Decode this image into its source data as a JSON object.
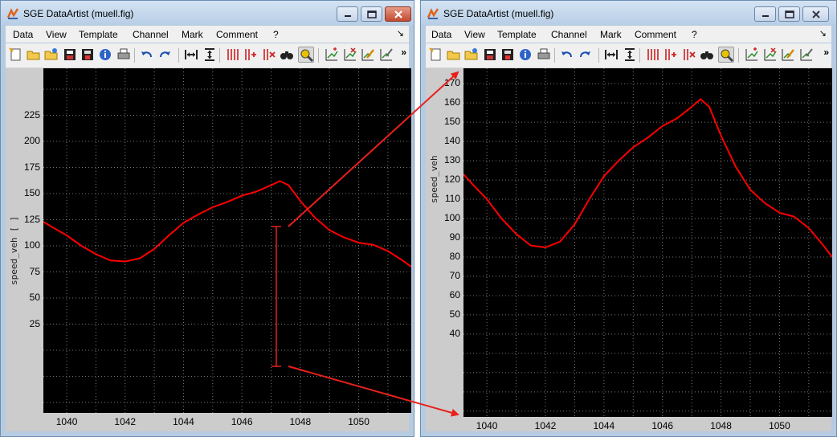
{
  "left_window": {
    "title": "SGE DataArtist (muell.fig)",
    "y_label": "speed_veh [ ]",
    "y_ticks": [
      "225",
      "200",
      "175",
      "150",
      "125",
      "100",
      "75",
      "50",
      "25"
    ],
    "x_ticks": [
      "1040",
      "1042",
      "1044",
      "1046",
      "1048",
      "1050"
    ]
  },
  "right_window": {
    "title": "SGE DataArtist (muell.fig)",
    "y_label": "speed_veh",
    "y_ticks": [
      "170",
      "160",
      "150",
      "140",
      "130",
      "120",
      "110",
      "100",
      "90",
      "80",
      "70",
      "60",
      "50",
      "40"
    ],
    "x_ticks": [
      "1040",
      "1042",
      "1044",
      "1046",
      "1048",
      "1050"
    ]
  },
  "menu": [
    "Data",
    "View",
    "Template",
    "Channel",
    "Mark",
    "Comment",
    "?"
  ],
  "menu_overflow": "↘",
  "toolbar_overflow": "»",
  "toolbar_icons": [
    "new-doc-icon",
    "open-folder-icon",
    "open-folder-alt-icon",
    "save-grid-icon",
    "save-disk-icon",
    "info-icon",
    "print-icon",
    "undo-icon",
    "redo-icon",
    "fit-x-icon",
    "fit-y-icon",
    "channels-icon",
    "add-channel-icon",
    "remove-channel-icon",
    "binoculars-icon",
    "zoom-tool-icon",
    "add-mark-icon",
    "delete-mark-icon",
    "edit-mark-icon",
    "mark-settings-icon"
  ],
  "colors": {
    "trace": "#ff0000",
    "plot_bg": "#000000",
    "grid": "#7a7a7a",
    "annotation": "#e8201c"
  },
  "chart_data": [
    {
      "type": "line",
      "title": "",
      "xlabel": "",
      "ylabel": "speed_veh [ ]",
      "xlim": [
        1039.2,
        1051.8
      ],
      "ylim": [
        -60,
        270
      ],
      "grid": true,
      "series": [
        {
          "x": [
            1039.2,
            1039.5,
            1040,
            1040.5,
            1041,
            1041.5,
            1042,
            1042.5,
            1043,
            1043.5,
            1044,
            1044.5,
            1045,
            1045.5,
            1046,
            1046.5,
            1047,
            1047.3,
            1047.6,
            1048,
            1048.5,
            1049,
            1049.5,
            1050,
            1050.5,
            1051,
            1051.5,
            1051.8
          ],
          "y": [
            123,
            118,
            110,
            100,
            92,
            86,
            85,
            88,
            97,
            110,
            122,
            130,
            137,
            142,
            148,
            152,
            158,
            162,
            158,
            143,
            127,
            115,
            108,
            103,
            101,
            95,
            86,
            80
          ]
        }
      ]
    },
    {
      "type": "line",
      "title": "",
      "xlabel": "",
      "ylabel": "speed_veh",
      "xlim": [
        1039.2,
        1051.8
      ],
      "ylim": [
        -3,
        178
      ],
      "grid": true,
      "series": [
        {
          "x": [
            1039.2,
            1039.5,
            1040,
            1040.5,
            1041,
            1041.5,
            1042,
            1042.5,
            1043,
            1043.5,
            1044,
            1044.5,
            1045,
            1045.5,
            1046,
            1046.5,
            1047,
            1047.3,
            1047.6,
            1048,
            1048.5,
            1049,
            1049.5,
            1050,
            1050.5,
            1051,
            1051.5,
            1051.8
          ],
          "y": [
            123,
            118,
            110,
            100,
            92,
            86,
            85,
            88,
            97,
            110,
            122,
            130,
            137,
            142,
            148,
            152,
            158,
            162,
            158,
            143,
            127,
            115,
            108,
            103,
            101,
            95,
            86,
            80
          ]
        }
      ]
    }
  ]
}
